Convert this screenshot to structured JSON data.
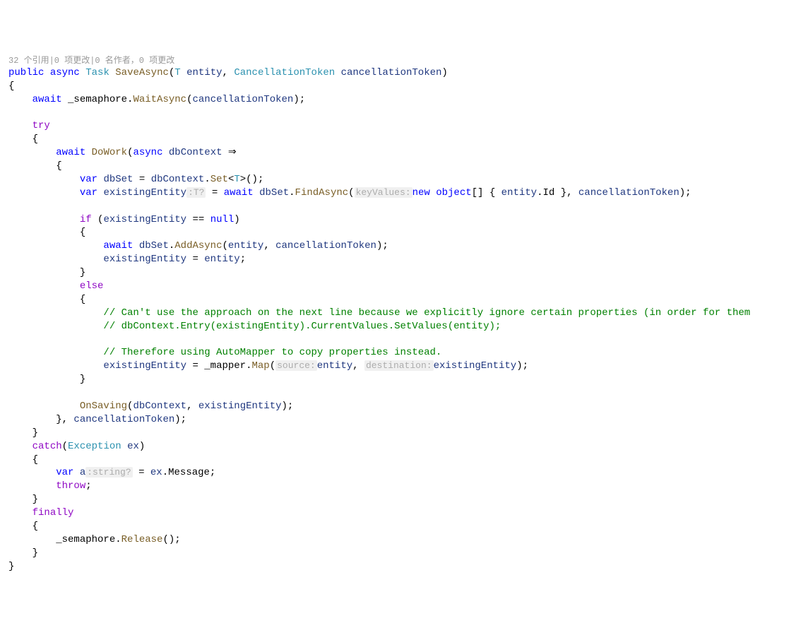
{
  "codelens": "32 个引用|0 项更改|0 名作者，0 项更改",
  "c": {
    "public": "public",
    "async": "async",
    "Task": "Task",
    "SaveAsync": "SaveAsync",
    "T": "T",
    "entity": "entity",
    "CancellationToken": "CancellationToken",
    "cancellationToken": "cancellationToken",
    "await": "await",
    "_semaphore": "_semaphore",
    "WaitAsync": "WaitAsync",
    "try": "try",
    "DoWork": "DoWork",
    "dbContext": "dbContext",
    "arrow": "⇒",
    "var": "var",
    "dbSet": "dbSet",
    "Set": "Set",
    "existingEntity": "existingEntity",
    "hintT": ":T?",
    "FindAsync": "FindAsync",
    "hintKeyValues": "keyValues:",
    "new": "new",
    "object": "object",
    "Id": "Id",
    "if": "if",
    "null": "null",
    "AddAsync": "AddAsync",
    "else": "else",
    "comment1": "// Can't use the approach on the next line because we explicitly ignore certain properties (in order for them",
    "comment2": "// dbContext.Entry(existingEntity).CurrentValues.SetValues(entity);",
    "comment3": "// Therefore using AutoMapper to copy properties instead.",
    "_mapper": "_mapper",
    "Map": "Map",
    "hintSource": "source:",
    "hintDest": "destination:",
    "OnSaving": "OnSaving",
    "catch": "catch",
    "Exception": "Exception",
    "ex": "ex",
    "a": "a",
    "hintString": ":string?",
    "Message": "Message",
    "throw": "throw",
    "finally": "finally",
    "Release": "Release"
  }
}
